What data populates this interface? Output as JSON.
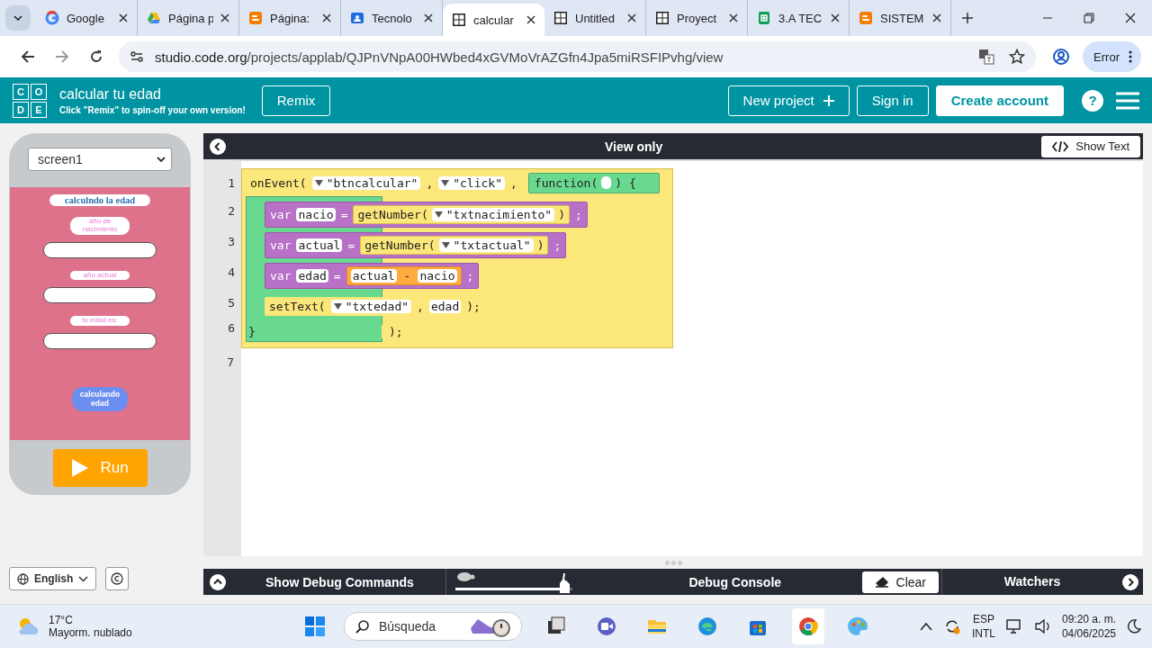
{
  "browser": {
    "tabs": [
      {
        "title": "Google",
        "kind": "google",
        "selected": false
      },
      {
        "title": "Página p",
        "kind": "drive",
        "selected": false
      },
      {
        "title": "Página:",
        "kind": "blogger",
        "selected": false
      },
      {
        "title": "Tecnolo",
        "kind": "classroom",
        "selected": false
      },
      {
        "title": "calcular",
        "kind": "code",
        "selected": true
      },
      {
        "title": "Untitled",
        "kind": "code",
        "selected": false
      },
      {
        "title": "Proyect",
        "kind": "code",
        "selected": false
      },
      {
        "title": "3.A TEC",
        "kind": "sheets",
        "selected": false
      },
      {
        "title": "SISTEM",
        "kind": "blogger",
        "selected": false
      }
    ],
    "url_host": "studio.code.org",
    "url_path": "/projects/applab/QJPnVNpA00HWbed4xGVMoVrAZGfn4Jpa5miRSFIPvhg/view",
    "profile_label": "Error"
  },
  "header": {
    "logo_letters": [
      "C",
      "O",
      "D",
      "E"
    ],
    "project_name": "calcular tu edad",
    "subtitle": "Click \"Remix\" to spin-off your own version!",
    "remix": "Remix",
    "new_project": "New project",
    "sign_in": "Sign in",
    "create_account": "Create account",
    "help": "?"
  },
  "app": {
    "screen": "screen1",
    "elements": [
      {
        "kind": "title",
        "text": "calculndo la edad"
      },
      {
        "kind": "label",
        "text": "año de nacimiento"
      },
      {
        "kind": "input"
      },
      {
        "kind": "label",
        "text": "año  actual"
      },
      {
        "kind": "input"
      },
      {
        "kind": "label",
        "text": "tu edad es:"
      },
      {
        "kind": "input"
      },
      {
        "kind": "button",
        "text": "calculando edad"
      }
    ],
    "run": "Run"
  },
  "footer": {
    "language": "English"
  },
  "editor": {
    "title": "View only",
    "show_text": "Show Text",
    "lines": [
      {
        "number": "1",
        "kind": "event",
        "parts": [
          {
            "kind": "text",
            "text": "onEvent("
          },
          {
            "kind": "dropdown",
            "text": "\"btncalcular\""
          },
          {
            "kind": "text",
            "text": ","
          },
          {
            "kind": "dropdown",
            "text": "\"click\""
          },
          {
            "kind": "text",
            "text": ","
          },
          {
            "kind": "function",
            "parts": [
              {
                "kind": "text",
                "text": "function("
              },
              {
                "kind": "slot"
              },
              {
                "kind": "text",
                "text": ") {"
              }
            ]
          }
        ],
        "children": [
          {
            "number": "2",
            "kind": "variable",
            "parts": [
              {
                "kind": "text",
                "text": "var"
              },
              {
                "kind": "field",
                "text": "nacio"
              },
              {
                "kind": "text",
                "text": "="
              },
              {
                "kind": "value",
                "parts": [
                  {
                    "kind": "text",
                    "text": "getNumber("
                  },
                  {
                    "kind": "dropdown",
                    "text": "\"txtnacimiento\""
                  },
                  {
                    "kind": "text",
                    "text": ")"
                  }
                ]
              },
              {
                "kind": "text",
                "text": ";"
              }
            ]
          },
          {
            "number": "3",
            "kind": "variable",
            "parts": [
              {
                "kind": "text",
                "text": "var"
              },
              {
                "kind": "field",
                "text": "actual"
              },
              {
                "kind": "text",
                "text": "="
              },
              {
                "kind": "value",
                "parts": [
                  {
                    "kind": "text",
                    "text": "getNumber("
                  },
                  {
                    "kind": "dropdown",
                    "text": "\"txtactual\""
                  },
                  {
                    "kind": "text",
                    "text": ")"
                  }
                ]
              },
              {
                "kind": "text",
                "text": ";"
              }
            ]
          },
          {
            "number": "4",
            "kind": "variable",
            "parts": [
              {
                "kind": "text",
                "text": "var"
              },
              {
                "kind": "field",
                "text": "edad"
              },
              {
                "kind": "text",
                "text": "="
              },
              {
                "kind": "math",
                "parts": [
                  {
                    "kind": "field",
                    "text": "actual"
                  },
                  {
                    "kind": "text",
                    "text": "-"
                  },
                  {
                    "kind": "field",
                    "text": "nacio"
                  }
                ]
              },
              {
                "kind": "text",
                "text": ";"
              }
            ]
          },
          {
            "number": "5",
            "kind": "event",
            "parts": [
              {
                "kind": "text",
                "text": "setText("
              },
              {
                "kind": "dropdown",
                "text": "\"txtedad\""
              },
              {
                "kind": "text",
                "text": ","
              },
              {
                "kind": "field",
                "text": "edad"
              },
              {
                "kind": "text",
                "text": ");"
              }
            ]
          }
        ],
        "closing": {
          "number": "6",
          "brace": "}",
          "end": ");"
        }
      },
      {
        "number": "7",
        "kind": "empty"
      }
    ]
  },
  "debug": {
    "show_commands": "Show Debug Commands",
    "speed": {
      "level": 0.93
    },
    "console": "Debug Console",
    "clear": "Clear",
    "watchers": "Watchers"
  },
  "taskbar": {
    "temperature": "17°C",
    "weather": "Mayorm. nublado",
    "search_placeholder": "Búsqueda",
    "language": "ESP",
    "layout": "INTL",
    "time": "09:20 a. m.",
    "date": "04/06/2025"
  }
}
